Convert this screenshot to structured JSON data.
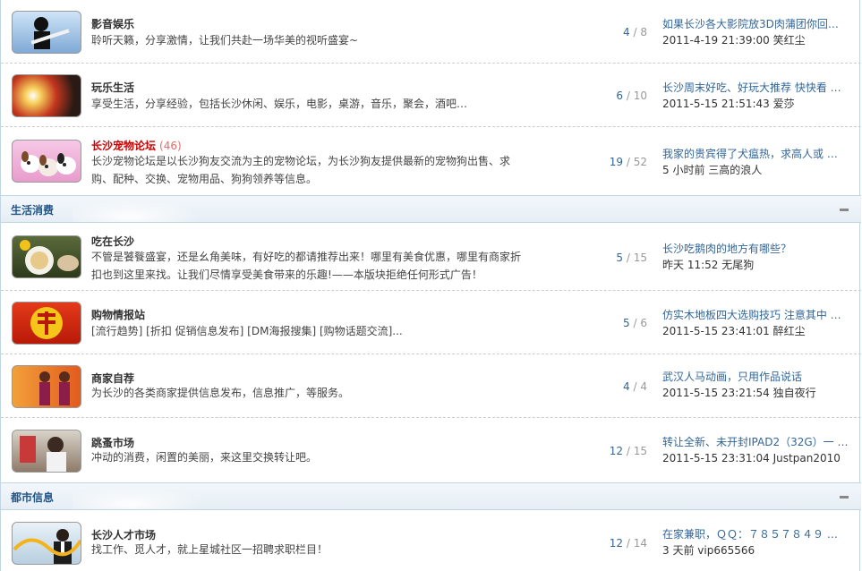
{
  "sections": [
    {
      "name": ""
    },
    {
      "name": "生活消费"
    },
    {
      "name": "都市信息"
    }
  ],
  "forums": [
    {
      "title": "影音娱乐",
      "today": "",
      "desc": "聆听天籁，分享激情，让我们共赴一场华美的视听盛宴~",
      "threads": "4",
      "posts": "8",
      "last_title": "如果长沙各大影院放3D肉蒲团你回…",
      "last_time": "2011-4-19 21:39:00",
      "last_user": "笑红尘",
      "icon": "music-guitar-thumb"
    },
    {
      "title": "玩乐生活",
      "today": "",
      "desc": "享受生活，分享经验，包括长沙休闲、娱乐，电影，桌游，音乐，聚会，酒吧…",
      "threads": "6",
      "posts": "10",
      "last_title": "长沙周末好吃、好玩大推荐 快快看 …",
      "last_time": "2011-5-15 21:51:43",
      "last_user": "爱莎",
      "icon": "leisure-thumb"
    },
    {
      "title": "长沙宠物论坛",
      "today": "(46)",
      "desc": "长沙宠物论坛是以长沙狗友交流为主的宠物论坛，为长沙狗友提供最新的宠物狗出售、求购、配种、交换、宠物用品、狗狗领养等信息。",
      "threads": "19",
      "posts": "52",
      "last_title": "我家的贵宾得了犬瘟热，求高人或 …",
      "last_time": "5 小时前",
      "last_user": "三高的浪人",
      "icon": "puppies-thumb"
    },
    {
      "title": "吃在长沙",
      "today": "",
      "desc": "不管是饕餮盛宴，还是幺角美味，有好吃的都请推荐出来！哪里有美食优惠，哪里有商家折扣也到这里来找。让我们尽情享受美食带来的乐趣!——本版块拒绝任何形式广告！",
      "threads": "5",
      "posts": "15",
      "last_title": "长沙吃鹅肉的地方有哪些？",
      "last_time": "昨天 11:52",
      "last_user": "无尾狗",
      "icon": "food-thumb"
    },
    {
      "title": "购物情报站",
      "today": "",
      "desc": "[流行趋势] [折扣 促销信息发布] [DM海报搜集] [购物话题交流]...",
      "threads": "5",
      "posts": "6",
      "last_title": "仿实木地板四大选购技巧 注意其中 …",
      "last_time": "2011-5-15 23:41:01",
      "last_user": "醉红尘",
      "icon": "hui-thumb"
    },
    {
      "title": "商家自荐",
      "today": "",
      "desc": "为长沙的各类商家提供信息发布，信息推广，等服务。",
      "threads": "4",
      "posts": "4",
      "last_title": "武汉人马动画，只用作品说话",
      "last_time": "2011-5-15 23:21:54",
      "last_user": "独自夜行",
      "icon": "welcome-thumb"
    },
    {
      "title": "跳蚤市场",
      "today": "",
      "desc": "冲动的消费，闲置的美丽，来这里交换转让吧。",
      "threads": "12",
      "posts": "15",
      "last_title": "转让全新、未开封IPAD2（32G）一 …",
      "last_time": "2011-5-15 23:31:04",
      "last_user": "Justpan2010",
      "icon": "flea-market-thumb"
    },
    {
      "title": "长沙人才市场",
      "today": "",
      "desc": "找工作、觅人才，就上星城社区一招聘求职栏目！",
      "threads": "12",
      "posts": "14",
      "last_title": "在家兼职，ＱＱ：７８５７８４９ …",
      "last_time": "3 天前",
      "last_user": "vip665566",
      "icon": "talent-thumb"
    }
  ],
  "colors": {
    "link": "#336699",
    "section_title": "#225588",
    "today_count": "#e36c6c",
    "highlight_title": "#cc0000"
  }
}
